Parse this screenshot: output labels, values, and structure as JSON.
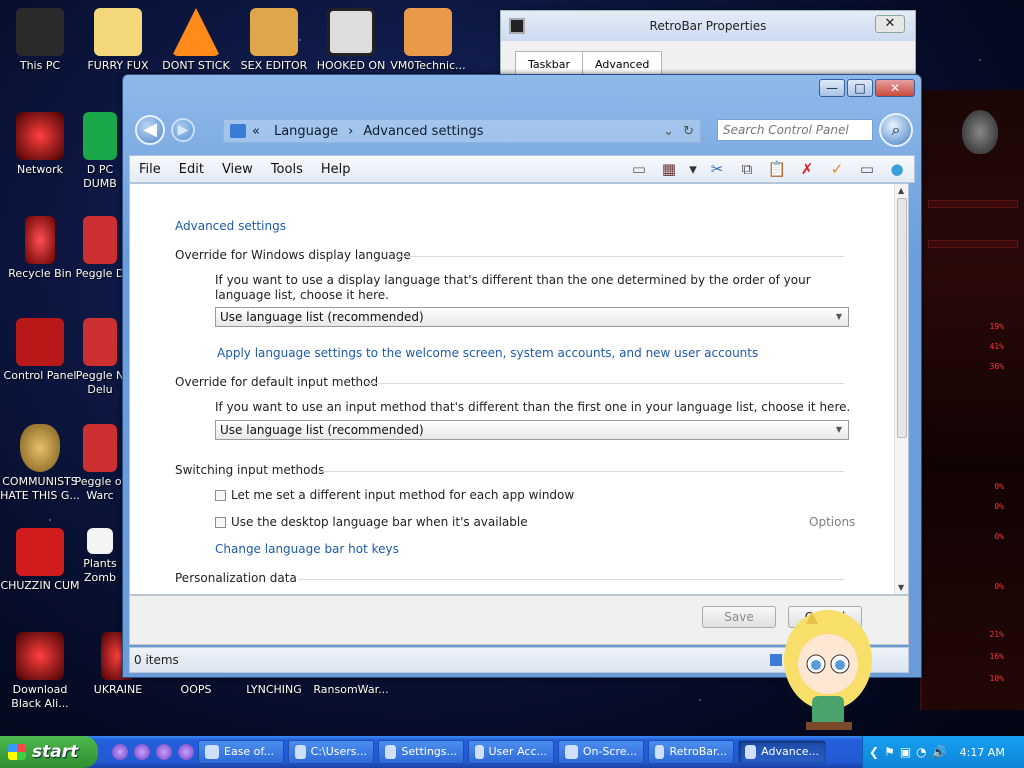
{
  "desktop_icons": [
    {
      "label": "This PC",
      "color": "#2a2a2a"
    },
    {
      "label": "FURRY FUX",
      "color": "#f3d77a"
    },
    {
      "label": "DONT STICK",
      "color": "#ff8c1a"
    },
    {
      "label": "SEX EDITOR",
      "color": "#e2a64a"
    },
    {
      "label": "HOOKED ON",
      "color": "#dddddd"
    },
    {
      "label": "VM0Technic...",
      "color": "#e89a4a"
    },
    {
      "label": "Network",
      "color": "#b01010"
    },
    {
      "label": "D PC DUMB",
      "color": "#1aa84a"
    },
    {
      "label": "Recycle Bin",
      "color": "#cc2020"
    },
    {
      "label": "Peggle D",
      "color": "#cc3030"
    },
    {
      "label": "Control Panel",
      "color": "#b81818"
    },
    {
      "label": "Peggle N Delu",
      "color": "#cc3030"
    },
    {
      "label": "COMMUNISTS HATE THIS G...",
      "color": "#c79a3a"
    },
    {
      "label": "Peggle of Warc",
      "color": "#cc3030"
    },
    {
      "label": "CHUZZIN CUM",
      "color": "#d21c1c"
    },
    {
      "label": "Plants Zomb",
      "color": "#f4f4f4"
    },
    {
      "label": "Download Black Ali...",
      "color": "#b51616"
    },
    {
      "label": "UKRAINE",
      "color": "#c01a1a"
    },
    {
      "label": "OOPS",
      "color": "#000000"
    },
    {
      "label": "LYNCHING",
      "color": "#000000"
    },
    {
      "label": "RansomWar...",
      "color": "#000000"
    }
  ],
  "retrobar": {
    "title": "RetroBar Properties",
    "tabs": [
      "Taskbar",
      "Advanced"
    ],
    "close": "✕"
  },
  "window": {
    "controls": {
      "minimize": "—",
      "maximize": "□",
      "close": "✕"
    },
    "nav": {
      "back": "◀",
      "forward": "▶"
    },
    "breadcrumb": [
      "Language",
      "Advanced settings"
    ],
    "breadcrumb_sep": "«",
    "search_placeholder": "Search Control Panel",
    "menus": [
      "File",
      "Edit",
      "View",
      "Tools",
      "Help"
    ],
    "toolbar_icons": [
      "▭",
      "▦",
      "▾",
      "✂",
      "⧉",
      "📋",
      "✗",
      "✓",
      "▭",
      "●"
    ],
    "content": {
      "page_link": "Advanced settings",
      "section1_heading": "Override for Windows display language",
      "section1_desc": "If you want to use a display language that's different than the one determined by the order of your language list, choose it here.",
      "section1_select": "Use language list (recommended)",
      "section1_link": "Apply language settings to the welcome screen, system accounts, and new user accounts",
      "section2_heading": "Override for default input method",
      "section2_desc": "If you want to use an input method that's different than the first one in your language list, choose it here.",
      "section2_select": "Use language list (recommended)",
      "section3_heading": "Switching input methods",
      "checkbox1": "Let me set a different input method for each app window",
      "checkbox2": "Use the desktop language bar when it's available",
      "options_label": "Options",
      "hotkeys_link": "Change language bar hot keys",
      "section4_heading": "Personalization data"
    },
    "buttons": {
      "save": "Save",
      "cancel": "Cancel"
    },
    "status": "0 items"
  },
  "taskbar": {
    "start_label": "start",
    "tasks": [
      "Ease of...",
      "C:\\Users...",
      "Settings...",
      "User Acc...",
      "On-Scre...",
      "RetroBar...",
      "Advance..."
    ],
    "active_task_index": 6,
    "tray_glyphs": [
      "❮",
      "⚑",
      "▣",
      "◔",
      "🔊"
    ],
    "clock": "4:17 AM"
  },
  "colors": {
    "accent_blue": "#1e5aa8",
    "taskbar_blue": "#245edc",
    "start_green": "#2e8f2e",
    "alien_red": "#ff3030"
  },
  "alien_readouts": [
    "19%",
    "41%",
    "36%",
    "0%",
    "0%",
    "0%",
    "0%",
    "21%",
    "16%",
    "10%"
  ]
}
